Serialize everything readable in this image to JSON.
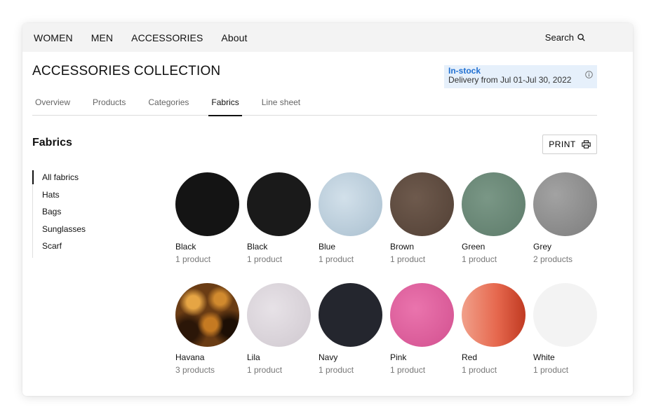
{
  "nav": {
    "links": [
      "WOMEN",
      "MEN",
      "ACCESSORIES",
      "About"
    ],
    "search_label": "Search"
  },
  "page": {
    "title": "ACCESSORIES COLLECTION"
  },
  "stock": {
    "status": "In-stock",
    "delivery": "Delivery from Jul 01-Jul 30, 2022"
  },
  "tabs": [
    {
      "label": "Overview",
      "active": false
    },
    {
      "label": "Products",
      "active": false
    },
    {
      "label": "Categories",
      "active": false
    },
    {
      "label": "Fabrics",
      "active": true
    },
    {
      "label": "Line sheet",
      "active": false
    }
  ],
  "section": {
    "title": "Fabrics",
    "print_label": "PRINT"
  },
  "sidebar": {
    "items": [
      {
        "label": "All fabrics",
        "active": true
      },
      {
        "label": "Hats",
        "active": false
      },
      {
        "label": "Bags",
        "active": false
      },
      {
        "label": "Sunglasses",
        "active": false
      },
      {
        "label": "Scarf",
        "active": false
      }
    ]
  },
  "fabrics": [
    {
      "name": "Black",
      "count": "1 product",
      "color": "#141414"
    },
    {
      "name": "Black",
      "count": "1 product",
      "color": "#1a1a1a"
    },
    {
      "name": "Blue",
      "count": "1 product",
      "color": "#b8cbd8"
    },
    {
      "name": "Brown",
      "count": "1 product",
      "color": "#5f4c40"
    },
    {
      "name": "Green",
      "count": "1 product",
      "color": "#6b8a78"
    },
    {
      "name": "Grey",
      "count": "2 products",
      "color": "#8e8e8e"
    },
    {
      "name": "Havana",
      "count": "3 products",
      "color": "#6a3c14"
    },
    {
      "name": "Lila",
      "count": "1 product",
      "color": "#d9d3d9"
    },
    {
      "name": "Navy",
      "count": "1 product",
      "color": "#24262e"
    },
    {
      "name": "Pink",
      "count": "1 product",
      "color": "#e0609e"
    },
    {
      "name": "Red",
      "count": "1 product",
      "color": "#e2654a"
    },
    {
      "name": "White",
      "count": "1 product",
      "color": "#f3f3f3"
    }
  ],
  "colors": {
    "accent": "#1f6fd1",
    "stock_bg": "#e6f0fb",
    "nav_bg": "#f3f3f3"
  },
  "icons": {
    "search": "search-icon",
    "info": "info-icon",
    "print": "printer-icon"
  }
}
